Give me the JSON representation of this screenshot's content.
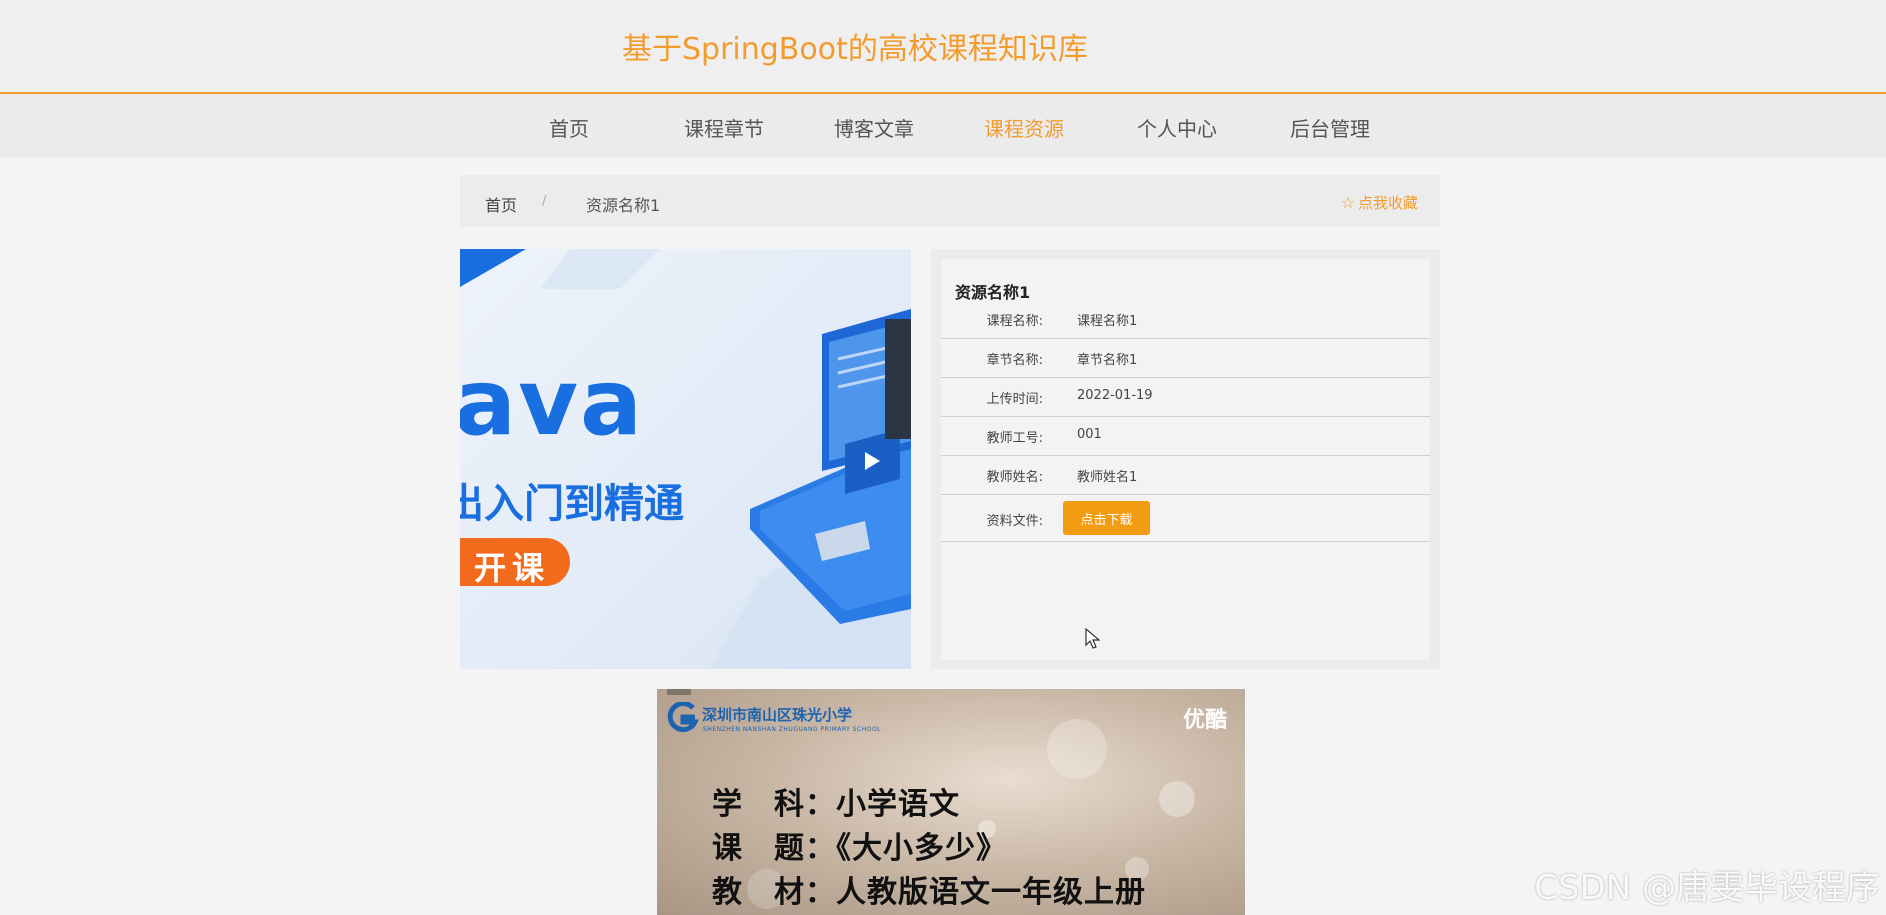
{
  "site": {
    "title": "基于SpringBoot的高校课程知识库"
  },
  "nav": {
    "items": [
      {
        "label": "首页"
      },
      {
        "label": "课程章节"
      },
      {
        "label": "博客文章"
      },
      {
        "label": "课程资源",
        "active": true
      },
      {
        "label": "个人中心"
      },
      {
        "label": "后台管理"
      }
    ]
  },
  "breadcrumb": {
    "home": "首页",
    "separator": "/",
    "current": "资源名称1"
  },
  "favorite": {
    "icon": "star-outline-icon",
    "label": "点我收藏"
  },
  "cover": {
    "text_big": "ava",
    "text_sub": "出入门到精通",
    "text_badge": "开课"
  },
  "details": {
    "title": "资源名称1",
    "rows": [
      {
        "label": "课程名称:",
        "value": "课程名称1"
      },
      {
        "label": "章节名称:",
        "value": "章节名称1"
      },
      {
        "label": "上传时间:",
        "value": "2022-01-19"
      },
      {
        "label": "教师工号:",
        "value": "001"
      },
      {
        "label": "教师姓名:",
        "value": "教师姓名1"
      }
    ],
    "file": {
      "label": "资料文件:",
      "button": "点击下载"
    }
  },
  "video": {
    "school_name": "深圳市南山区珠光小学",
    "school_sub": "SHENZHEN NANSHAN ZHUGUANG PRIMARY SCHOOL",
    "brand": "优酷",
    "lines": [
      "学　科：小学语文",
      "课　题：《大小多少》",
      "教　材：人教版语文一年级上册"
    ]
  },
  "watermark": "CSDN @唐雯毕设程序",
  "colors": {
    "accent": "#f39c2e",
    "button": "#f39c12",
    "cover_blue": "#1a6fe0",
    "cover_orange": "#f26b1d"
  }
}
